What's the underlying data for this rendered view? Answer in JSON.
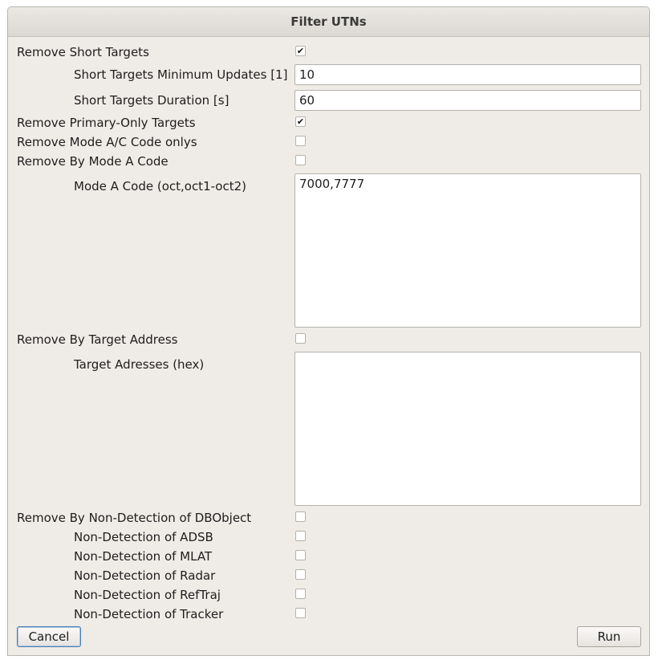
{
  "window": {
    "title": "Filter UTNs"
  },
  "options": {
    "remove_short_targets": {
      "label": "Remove Short Targets",
      "checked": "✔"
    },
    "short_min_updates": {
      "label": "Short Targets Minimum Updates [1]",
      "value": "10"
    },
    "short_duration": {
      "label": "Short Targets Duration [s]",
      "value": "60"
    },
    "remove_primary_only": {
      "label": "Remove Primary-Only Targets",
      "checked": "✔"
    },
    "remove_mode_ac_only": {
      "label": "Remove Mode A/C Code onlys",
      "checked": ""
    },
    "remove_by_mode_a": {
      "label": "Remove By Mode A Code",
      "checked": ""
    },
    "mode_a_codes": {
      "label": "Mode A Code (oct,oct1-oct2)",
      "value": "7000,7777"
    },
    "remove_by_target_address": {
      "label": "Remove By Target Address",
      "checked": ""
    },
    "target_addresses": {
      "label": "Target Adresses (hex)",
      "value": ""
    },
    "remove_by_non_detection": {
      "label": "Remove By Non-Detection of DBObject",
      "checked": ""
    },
    "non_detection": [
      {
        "label": "Non-Detection of ADSB",
        "checked": ""
      },
      {
        "label": "Non-Detection of MLAT",
        "checked": ""
      },
      {
        "label": "Non-Detection of Radar",
        "checked": ""
      },
      {
        "label": "Non-Detection of RefTraj",
        "checked": ""
      },
      {
        "label": "Non-Detection of Tracker",
        "checked": ""
      }
    ]
  },
  "buttons": {
    "cancel": "Cancel",
    "run": "Run"
  }
}
